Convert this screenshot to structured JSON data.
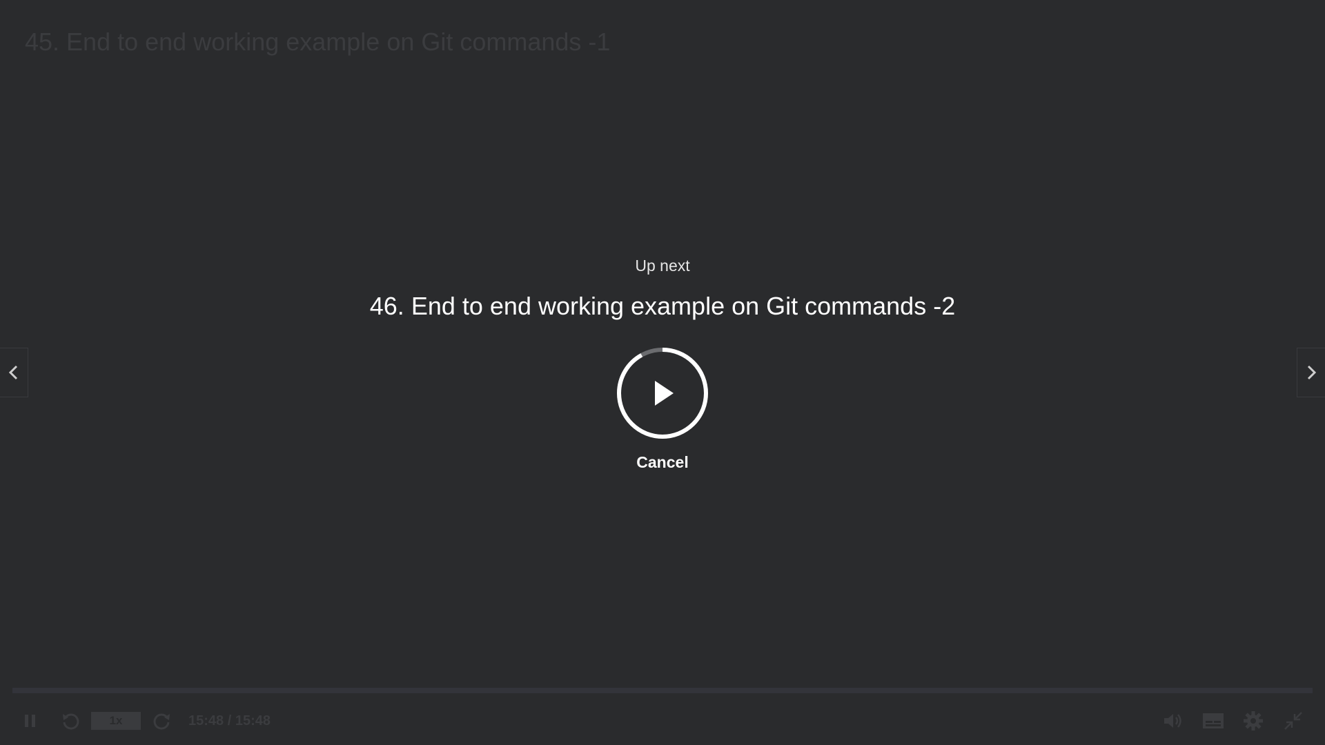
{
  "player": {
    "current_title": "45. End to end working example on Git commands -1",
    "up_next_label": "Up next",
    "next_title": "46. End to end working example on Git commands -2",
    "cancel_label": "Cancel",
    "autoplay_countdown_fraction": 0.92
  },
  "controls": {
    "speed": "1x",
    "time": "15:48 / 15:48",
    "playback_progress": 1.0
  },
  "icons": {
    "pause": "pause-icon",
    "rewind": "rewind-icon",
    "forward": "forward-icon",
    "volume": "volume-icon",
    "captions": "captions-icon",
    "settings": "gear-icon",
    "exit_fullscreen": "exit-fullscreen-icon",
    "prev": "chevron-left-icon",
    "next": "chevron-right-icon",
    "play": "play-icon"
  },
  "colors": {
    "background": "#2a2b2d",
    "dim_controls": "#3b3c3f",
    "foreground": "#ffffff",
    "ring_remaining": "#6b6c6f"
  }
}
